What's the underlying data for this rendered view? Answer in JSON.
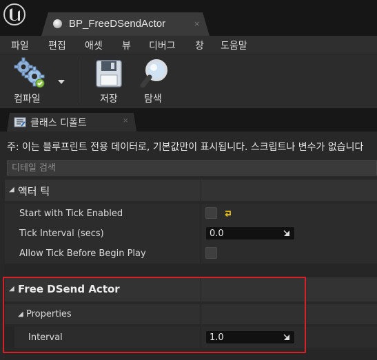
{
  "window": {
    "tab_title": "BP_FreeDSendActor",
    "tab_close": "×"
  },
  "menu": {
    "items": [
      "파일",
      "편집",
      "애셋",
      "뷰",
      "디버그",
      "창",
      "도움말"
    ]
  },
  "toolbar": {
    "compile_label": "컴파일",
    "save_label": "저장",
    "browse_label": "탐색"
  },
  "panel": {
    "tab_label": "클래스 디폴트",
    "tab_close": "×",
    "notice": "주: 이는 블루프린트 전용 데이터로, 기본값만이 표시됩니다. 스크립트나 변수가 없습니다",
    "search_placeholder": "디테일 검색"
  },
  "sections": {
    "actor_tick": {
      "title": "액터 틱",
      "properties": {
        "start_with_tick": {
          "label": "Start with Tick Enabled",
          "checked": false,
          "reset_icon": "reset-to-default-arrow-icon"
        },
        "tick_interval": {
          "label": "Tick Interval (secs)",
          "value": "0.0"
        },
        "allow_tick": {
          "label": "Allow Tick Before Begin Play",
          "checked": false
        }
      }
    },
    "free_dsend": {
      "title": "Free DSend Actor",
      "subcategory": "Properties",
      "properties": {
        "interval": {
          "label": "Interval",
          "value": "1.0"
        }
      }
    }
  },
  "colors": {
    "highlight_border": "#d2232a",
    "reset_arrow": "#e8c21a"
  }
}
